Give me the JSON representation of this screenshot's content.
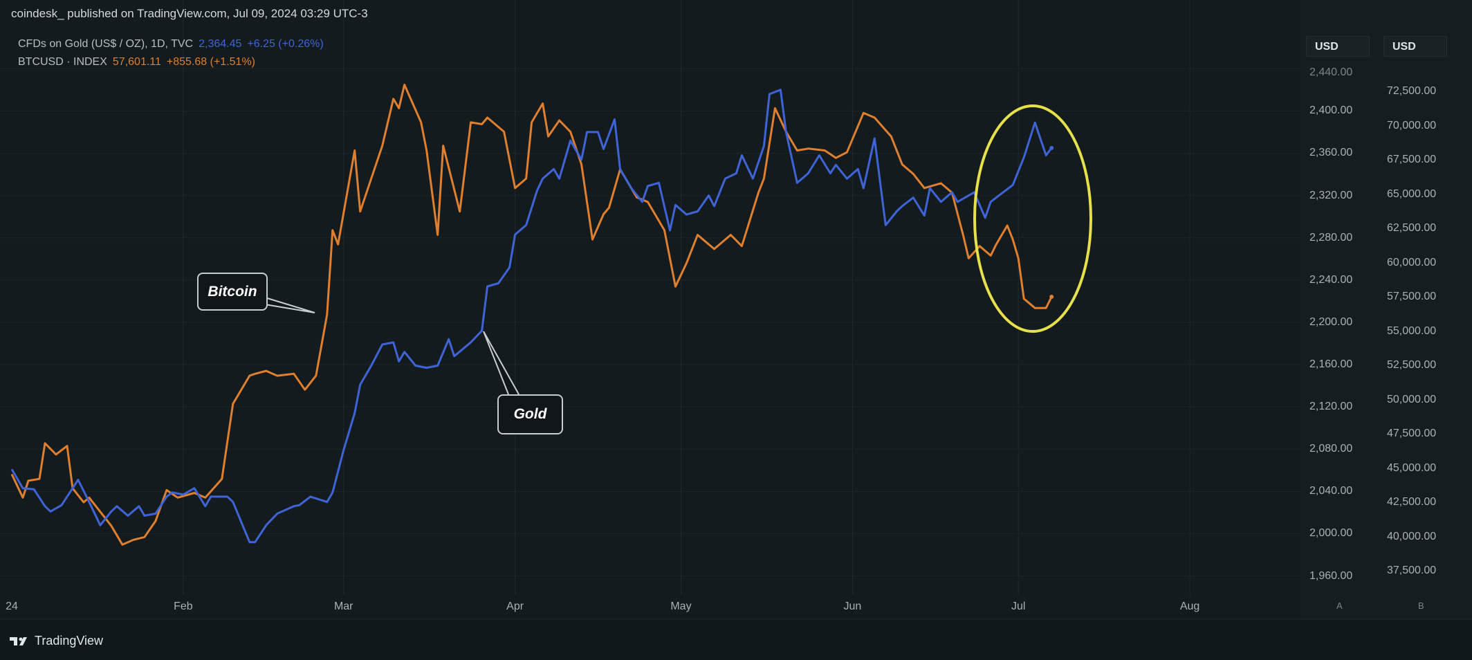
{
  "header": {
    "publisher": "coindesk_ published on TradingView.com, Jul 09, 2024 03:29 UTC-3"
  },
  "legend": {
    "gold": {
      "name": "CFDs on Gold (US$ / OZ), 1D, TVC",
      "price": "2,364.45",
      "change": "+6.25 (+0.26%)",
      "color": "#3f64d8"
    },
    "btc": {
      "name": "BTCUSD · INDEX",
      "price": "57,601.11",
      "change": "+855.68 (+1.51%)",
      "color": "#e07f2e"
    }
  },
  "axis_buttons": {
    "left": "USD",
    "right": "USD"
  },
  "scale_labels": {
    "left": "A",
    "right": "B"
  },
  "branding": {
    "logo_text": "TradingView"
  },
  "annotations": {
    "bitcoin": "Bitcoin",
    "gold": "Gold",
    "highlight_color": "#e6e04a"
  },
  "chart_data": {
    "type": "line",
    "title": "Gold vs Bitcoin, 2024",
    "x_unit": "day of year 2024",
    "x_ticks": [
      {
        "label": "24",
        "day": 1
      },
      {
        "label": "Feb",
        "day": 32
      },
      {
        "label": "Mar",
        "day": 61
      },
      {
        "label": "Apr",
        "day": 92
      },
      {
        "label": "May",
        "day": 122
      },
      {
        "label": "Jun",
        "day": 153
      },
      {
        "label": "Jul",
        "day": 183
      },
      {
        "label": "Aug",
        "day": 214
      }
    ],
    "xlim": [
      1,
      234
    ],
    "axes": {
      "gold": {
        "ylim": [
          1942,
          2505
        ],
        "ticks": [
          "2,440.00",
          "2,400.00",
          "2,360.00",
          "2,320.00",
          "2,280.00",
          "2,240.00",
          "2,200.00",
          "2,160.00",
          "2,120.00",
          "2,080.00",
          "2,040.00",
          "2,000.00",
          "1,960.00"
        ],
        "tick_values": [
          2440,
          2400,
          2360,
          2320,
          2280,
          2240,
          2200,
          2160,
          2120,
          2080,
          2040,
          2000,
          1960
        ]
      },
      "btc": {
        "ylim": [
          35733,
          79167
        ],
        "ticks": [
          "72,500.00",
          "70,000.00",
          "67,500.00",
          "65,000.00",
          "62,500.00",
          "60,000.00",
          "57,500.00",
          "55,000.00",
          "52,500.00",
          "50,000.00",
          "47,500.00",
          "45,000.00",
          "42,500.00",
          "40,000.00",
          "37,500.00"
        ],
        "tick_values": [
          72500,
          70000,
          67500,
          65000,
          62500,
          60000,
          57500,
          55000,
          52500,
          50000,
          47500,
          45000,
          42500,
          40000,
          37500
        ]
      }
    },
    "series": [
      {
        "name": "Gold",
        "axis": "gold",
        "color": "#3f64d8",
        "x": [
          1,
          3,
          5,
          7,
          8,
          10,
          12,
          13,
          15,
          17,
          19,
          20,
          22,
          24,
          25,
          27,
          29,
          30,
          32,
          34,
          36,
          37,
          40,
          41,
          44,
          45,
          47,
          49,
          52,
          53,
          55,
          58,
          59,
          61,
          63,
          64,
          66,
          68,
          70,
          71,
          72,
          74,
          76,
          78,
          80,
          81,
          84,
          86,
          87,
          89,
          91,
          92,
          94,
          96,
          97,
          99,
          100,
          102,
          104,
          105,
          107,
          108,
          110,
          111,
          113,
          115,
          116,
          118,
          120,
          121,
          123,
          125,
          127,
          128,
          130,
          132,
          133,
          135,
          137,
          138,
          140,
          141,
          143,
          145,
          147,
          149,
          150,
          152,
          154,
          155,
          157,
          159,
          161,
          162,
          164,
          166,
          167,
          169,
          171,
          172,
          175,
          177,
          178,
          179,
          182,
          184,
          186,
          188,
          189
        ],
        "values": [
          2061,
          2043,
          2042,
          2026,
          2021,
          2027,
          2043,
          2051,
          2030,
          2008,
          2021,
          2026,
          2017,
          2026,
          2017,
          2019,
          2035,
          2039,
          2037,
          2043,
          2026,
          2035,
          2035,
          2030,
          1992,
          1992,
          2008,
          2019,
          2026,
          2027,
          2035,
          2030,
          2039,
          2079,
          2114,
          2141,
          2159,
          2179,
          2181,
          2163,
          2172,
          2159,
          2157,
          2159,
          2184,
          2168,
          2181,
          2192,
          2234,
          2237,
          2252,
          2283,
          2292,
          2325,
          2336,
          2345,
          2336,
          2372,
          2354,
          2380,
          2380,
          2364,
          2392,
          2345,
          2327,
          2314,
          2329,
          2332,
          2287,
          2311,
          2302,
          2305,
          2320,
          2310,
          2336,
          2341,
          2358,
          2336,
          2367,
          2416,
          2420,
          2380,
          2332,
          2341,
          2358,
          2341,
          2349,
          2336,
          2345,
          2327,
          2374,
          2292,
          2305,
          2310,
          2318,
          2301,
          2327,
          2314,
          2323,
          2314,
          2323,
          2299,
          2314,
          2318,
          2330,
          2356,
          2389,
          2358,
          2365
        ]
      },
      {
        "name": "Bitcoin",
        "axis": "btc",
        "color": "#e07f2e",
        "x": [
          1,
          3,
          4,
          6,
          7,
          9,
          11,
          12,
          14,
          15,
          17,
          19,
          21,
          23,
          25,
          27,
          29,
          31,
          34,
          36,
          39,
          41,
          44,
          45,
          47,
          49,
          52,
          54,
          56,
          58,
          59,
          60,
          63,
          64,
          66,
          68,
          70,
          71,
          72,
          75,
          76,
          78,
          79,
          82,
          84,
          86,
          87,
          90,
          92,
          94,
          95,
          97,
          98,
          100,
          102,
          104,
          106,
          108,
          109,
          111,
          114,
          116,
          119,
          121,
          123,
          125,
          128,
          131,
          133,
          136,
          137,
          139,
          141,
          143,
          145,
          148,
          150,
          152,
          155,
          157,
          160,
          162,
          164,
          166,
          169,
          171,
          173,
          174,
          176,
          178,
          179,
          181,
          182,
          183,
          184,
          186,
          188,
          189
        ],
        "values": [
          44550,
          42840,
          44070,
          44210,
          46810,
          45990,
          46610,
          43520,
          42500,
          42840,
          41810,
          40780,
          39410,
          39760,
          39960,
          41130,
          43390,
          42840,
          43180,
          42840,
          44210,
          49690,
          51740,
          51880,
          52090,
          51740,
          51880,
          50720,
          51740,
          56200,
          62360,
          61330,
          68180,
          63730,
          66130,
          68530,
          71950,
          71270,
          72980,
          70240,
          68180,
          62020,
          68530,
          63730,
          70240,
          70100,
          70580,
          69550,
          65440,
          66130,
          70240,
          71610,
          69210,
          70380,
          69550,
          67160,
          61680,
          63530,
          64010,
          66810,
          64760,
          64420,
          62360,
          58250,
          59960,
          62020,
          60990,
          62020,
          61200,
          65100,
          66130,
          71270,
          69550,
          68180,
          68320,
          68180,
          67640,
          68050,
          70920,
          70580,
          69210,
          67160,
          66470,
          65440,
          65790,
          65100,
          62020,
          60310,
          61200,
          60510,
          61330,
          62700,
          61680,
          60310,
          57360,
          56680,
          56680,
          57500
        ]
      }
    ],
    "grid": true,
    "legend_position": "top-left"
  }
}
